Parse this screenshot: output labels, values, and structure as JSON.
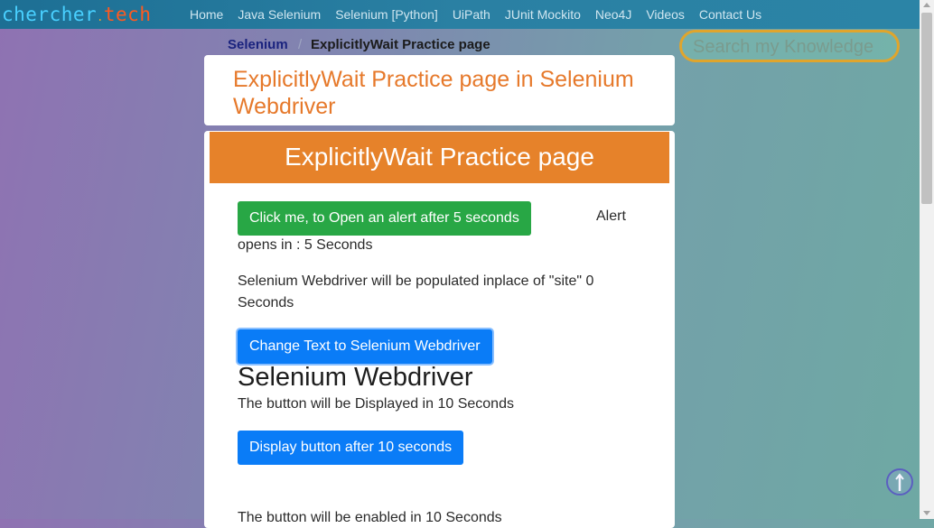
{
  "logo": {
    "part1": "chercher",
    "dot": ".",
    "part2": "tech"
  },
  "nav": [
    "Home",
    "Java Selenium",
    "Selenium [Python]",
    "UiPath",
    "JUnit Mockito",
    "Neo4J",
    "Videos",
    "Contact Us"
  ],
  "breadcrumb": {
    "parent": "Selenium",
    "separator": "/",
    "current": "ExplicitlyWait Practice page"
  },
  "search": {
    "placeholder": "Search my Knowledge"
  },
  "page": {
    "title": "ExplicitlyWait Practice page in Selenium Webdriver",
    "banner": "ExplicitlyWait Practice page",
    "alert_button": "Click me, to Open an alert after 5 seconds",
    "alert_label": "Alert",
    "alert_info": "opens in : 5 Seconds",
    "site_text": "Selenium Webdriver will be populated inplace of \"site\" 0 Seconds",
    "change_text_button": "Change Text to Selenium Webdriver",
    "populated_heading": "Selenium Webdriver",
    "display_info": "The button will be Displayed in 10 Seconds",
    "display_button": "Display button after 10 seconds",
    "enable_info": "The button will be enabled in 10 Seconds"
  },
  "colors": {
    "accent_orange": "#e6822a",
    "button_green": "#28a745",
    "button_blue": "#0a7cf7"
  }
}
